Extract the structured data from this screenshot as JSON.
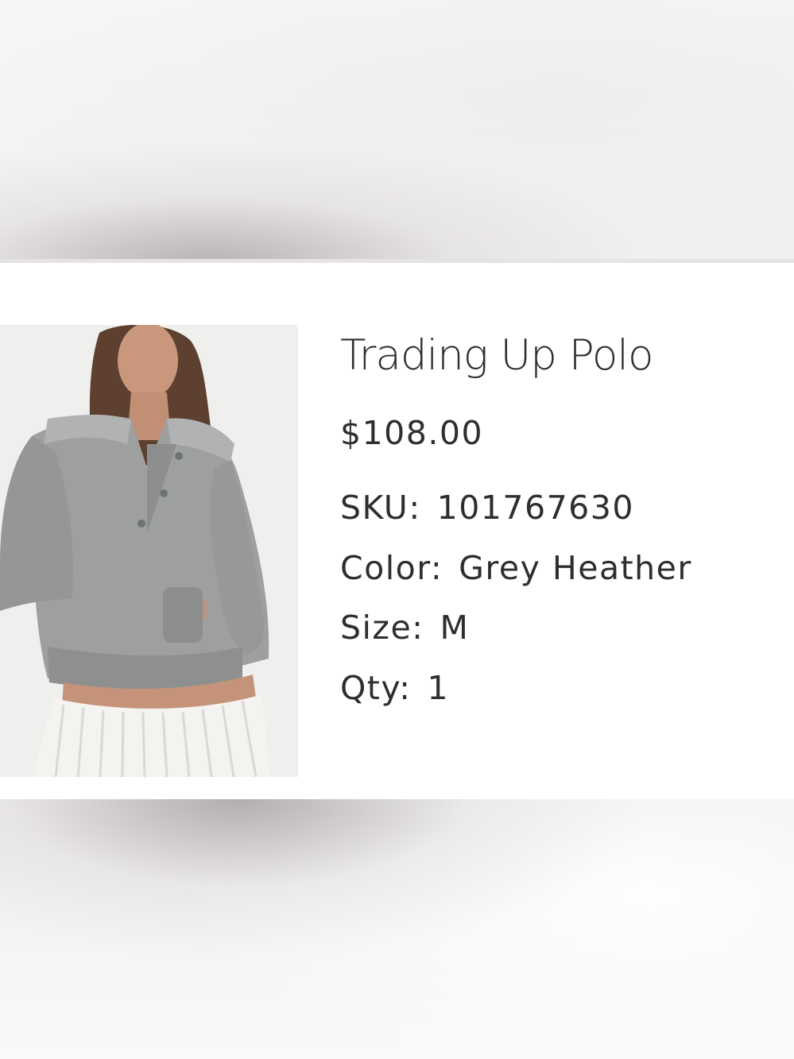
{
  "item": {
    "name": "Trading Up Polo",
    "price": "$108.00",
    "sku_label": "SKU:",
    "sku_value": "101767630",
    "color_label": "Color:",
    "color_value": "Grey Heather",
    "size_label": "Size:",
    "size_value": "M",
    "qty_label": "Qty:",
    "qty_value": "1"
  },
  "colors": {
    "text": "#2e2e2e",
    "sweater": "#9a9c9c",
    "skirt": "#f3f2ef",
    "image_background": "#eeeeee"
  }
}
